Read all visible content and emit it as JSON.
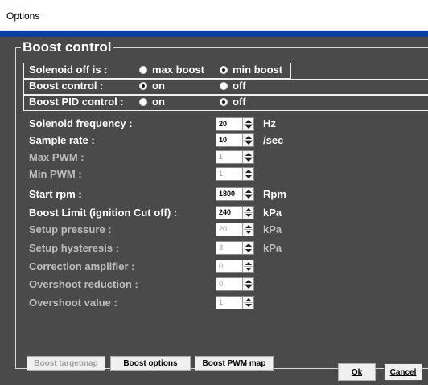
{
  "window": {
    "title": "Options"
  },
  "group": {
    "title": "Boost control"
  },
  "solenoid_off": {
    "label": "Solenoid off is :",
    "option_a": "max boost",
    "option_b": "min boost",
    "selected": "min boost"
  },
  "boost_control": {
    "label": "Boost control :",
    "option_a": "on",
    "option_b": "off",
    "selected": "on"
  },
  "boost_pid": {
    "label": "Boost PID control :",
    "option_a": "on",
    "option_b": "off",
    "selected": "off"
  },
  "settings": [
    {
      "label": "Solenoid frequency :",
      "value": "20",
      "unit": "Hz",
      "enabled": true
    },
    {
      "label": "Sample rate :",
      "value": "10",
      "unit": "/sec",
      "enabled": true
    },
    {
      "label": "Max PWM :",
      "value": "1",
      "unit": "",
      "enabled": false
    },
    {
      "label": "Min PWM :",
      "value": "1",
      "unit": "",
      "enabled": false
    },
    {
      "label": "Start rpm :",
      "value": "1800",
      "unit": "Rpm",
      "enabled": true
    },
    {
      "label": "Boost Limit (ignition Cut off) :",
      "value": "240",
      "unit": "kPa",
      "enabled": true
    },
    {
      "label": "Setup pressure :",
      "value": "20",
      "unit": "kPa",
      "enabled": false
    },
    {
      "label": "Setup hysteresis :",
      "value": "3",
      "unit": "kPa",
      "enabled": false
    },
    {
      "label": "Correction amplifier :",
      "value": "0",
      "unit": "",
      "enabled": false
    },
    {
      "label": "Overshoot reduction :",
      "value": "0",
      "unit": "",
      "enabled": false
    },
    {
      "label": "Overshoot value :",
      "value": "1",
      "unit": "",
      "enabled": false
    }
  ],
  "buttons": {
    "boost_targetmap": "Boost targetmap",
    "boost_options": "Boost options",
    "boost_pwm_map": "Boost PWM map",
    "ok": "Ok",
    "cancel": "Cancel"
  },
  "colors": {
    "background": "#4a4a4a",
    "accent_strip": "#0c3ea6"
  }
}
